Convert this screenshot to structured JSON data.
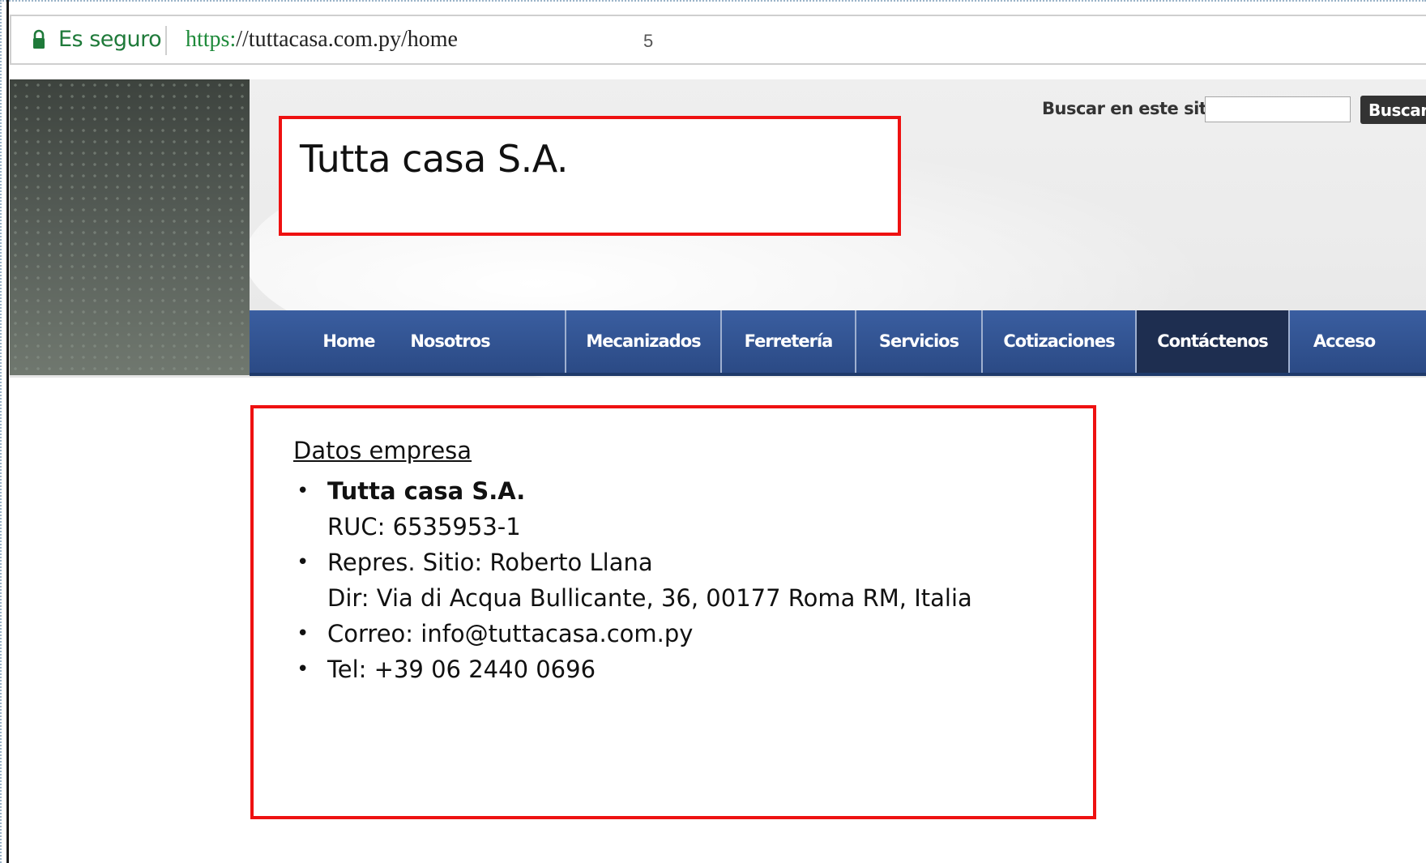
{
  "browser": {
    "secure_label": "Es seguro",
    "url_scheme": "https:",
    "url_rest": "//tuttacasa.com.py/home",
    "cursor_glyph": "5"
  },
  "header": {
    "site_title": "Tutta casa S.A.",
    "search_label": "Buscar en este sitio:",
    "search_placeholder": "",
    "search_button": "Buscar"
  },
  "nav": {
    "items": [
      {
        "label": "Home"
      },
      {
        "label": "Nosotros"
      },
      {
        "label": "Mecanizados"
      },
      {
        "label": "Ferretería"
      },
      {
        "label": "Servicios"
      },
      {
        "label": "Cotizaciones"
      },
      {
        "label": "Contáctenos",
        "active": true
      },
      {
        "label": "Acceso"
      }
    ]
  },
  "content": {
    "heading": "Datos empresa",
    "company_name": "Tutta casa S.A.",
    "ruc": "RUC: 6535953-1",
    "representative": "Repres. Sitio: Roberto Llana",
    "address": "Dir: Via di Acqua Bullicante, 36, 00177 Roma RM, Italia",
    "email": "Correo: info@tuttacasa.com.py",
    "phone": "Tel: +39 06 2440 0696"
  },
  "colors": {
    "highlight_border": "#ee1111",
    "nav_bg": "#2b4a85",
    "nav_active_bg": "#1e2e50",
    "secure_green": "#1f7a3a"
  },
  "icons": [
    "lock-icon"
  ]
}
